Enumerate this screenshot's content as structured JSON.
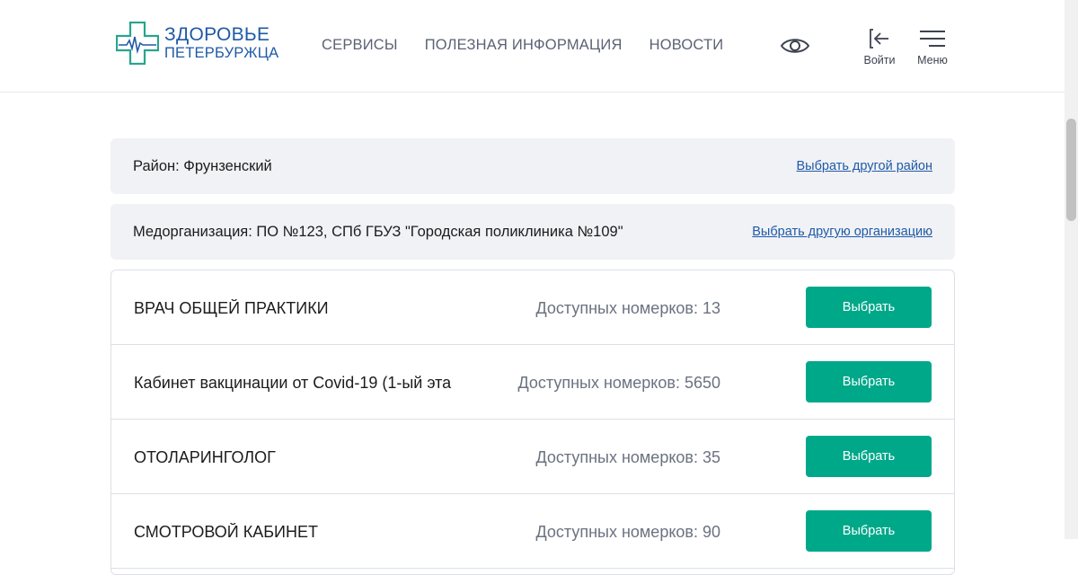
{
  "header": {
    "logo": {
      "line1": "ЗДОРОВЬЕ",
      "line2": "ПЕТЕРБУРЖЦА",
      "cross_color": "#27a58c",
      "text_color": "#1f5aa6"
    },
    "nav": [
      "СЕРВИСЫ",
      "ПОЛЕЗНАЯ ИНФОРМАЦИЯ",
      "НОВОСТИ"
    ],
    "accessibility_icon": "eye-icon",
    "login": {
      "label": "Войти",
      "icon": "login-icon"
    },
    "menu": {
      "label": "Меню",
      "icon": "hamburger-icon"
    }
  },
  "district": {
    "label": "Район: Фрунзенский",
    "link": "Выбрать другой район"
  },
  "organization": {
    "label": "Медорганизация: ПО №123, СПб ГБУЗ \"Городская поликлиника №109\"",
    "link": "Выбрать другую организацию"
  },
  "specialties": [
    {
      "name": "ВРАЧ ОБЩЕЙ ПРАКТИКИ",
      "count": "Доступных номерков: 13",
      "button": "Выбрать"
    },
    {
      "name": "Кабинет вакцинации от Covid-19 (1-ый эта",
      "count": "Доступных номерков: 5650",
      "button": "Выбрать"
    },
    {
      "name": "ОТОЛАРИНГОЛОГ",
      "count": "Доступных номерков: 35",
      "button": "Выбрать"
    },
    {
      "name": "СМОТРОВОЙ КАБИНЕТ",
      "count": "Доступных номерков: 90",
      "button": "Выбрать"
    }
  ],
  "colors": {
    "accent": "#00a88a",
    "link": "#1f5aa6",
    "panel": "#f1f2f6"
  }
}
